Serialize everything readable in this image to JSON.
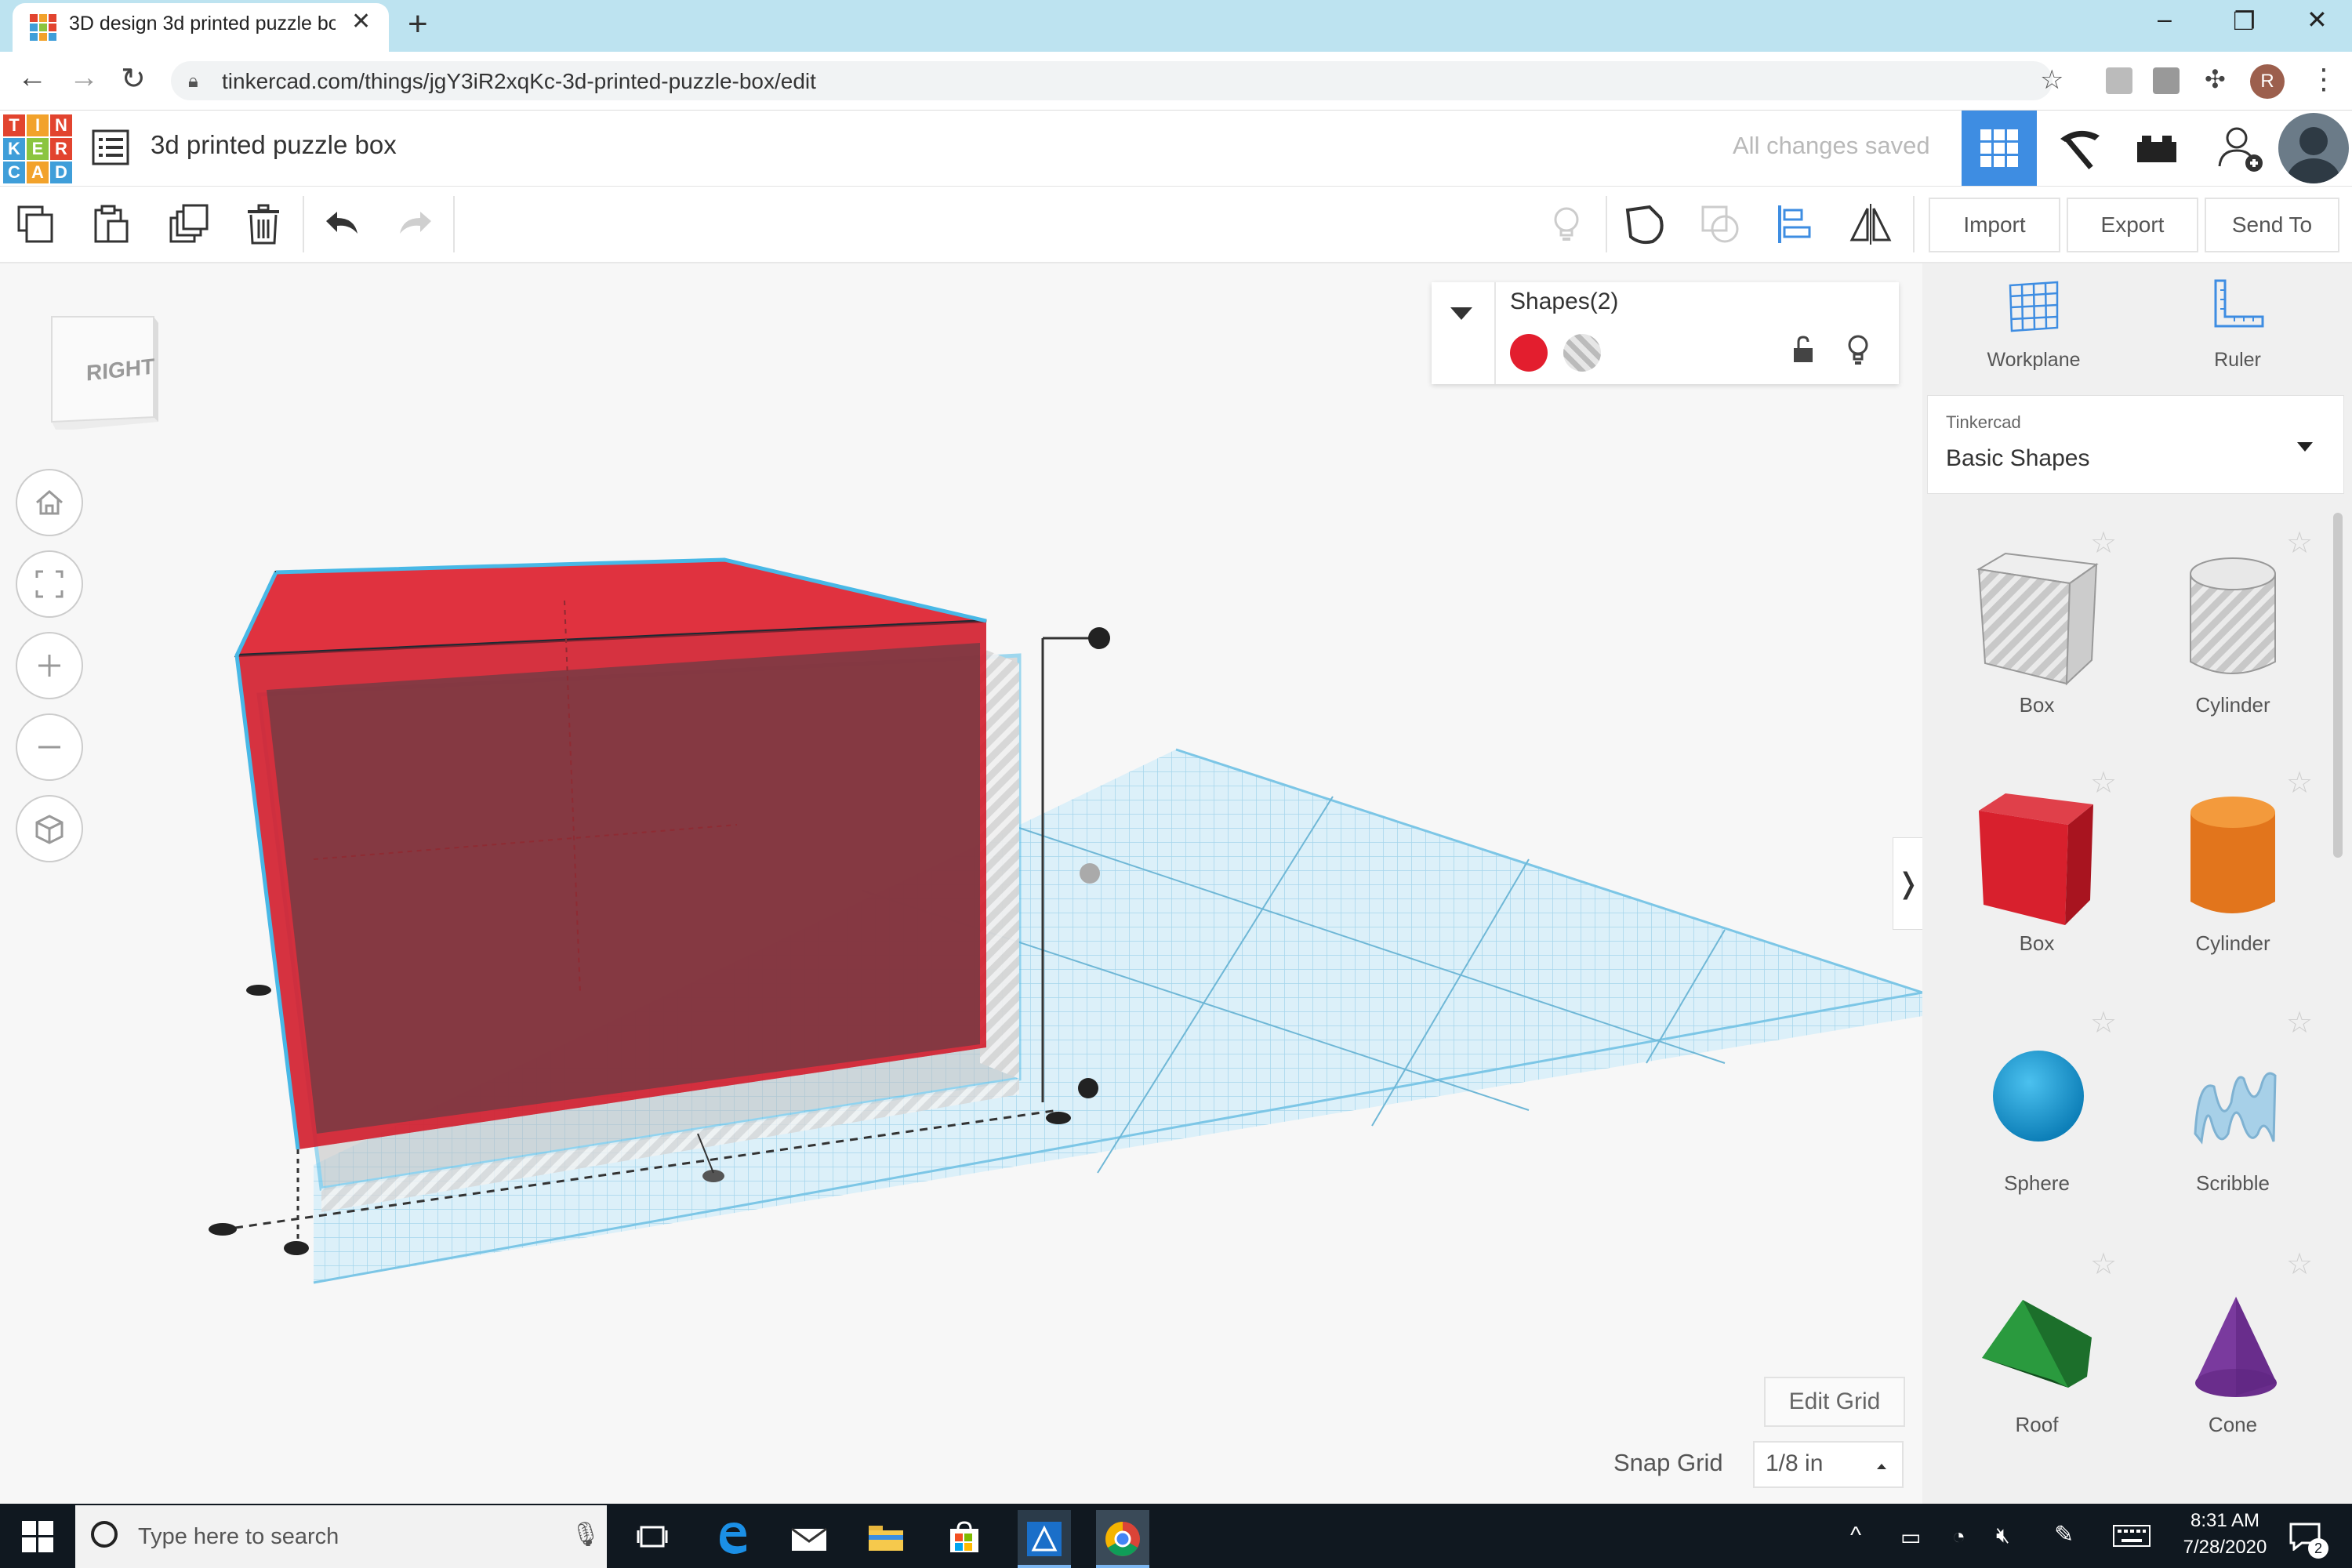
{
  "browser": {
    "tab_title": "3D design 3d printed puzzle box",
    "url": "tinkercad.com/things/jgY3iR2xqKc-3d-printed-puzzle-box/edit",
    "profile_initial": "R"
  },
  "app": {
    "logo_letters": [
      "T",
      "I",
      "N",
      "K",
      "E",
      "R",
      "C",
      "A",
      "D"
    ],
    "logo_colors": [
      "#e2442f",
      "#f2a22b",
      "#e2442f",
      "#3f9ed9",
      "#8bc53f",
      "#e2442f",
      "#3f9ed9",
      "#f2a22b",
      "#3f9ed9"
    ],
    "doc_title": "3d printed puzzle box",
    "save_status": "All changes saved",
    "accent": "#3e8de2"
  },
  "toolbar": {
    "import_label": "Import",
    "export_label": "Export",
    "send_to_label": "Send To"
  },
  "viewcube": {
    "face_label": "RIGHT"
  },
  "inspector": {
    "title": "Shapes(2)",
    "solid_color": "#e31e2e"
  },
  "grid": {
    "edit_label": "Edit Grid",
    "snap_label": "Snap Grid",
    "snap_value": "1/8 in"
  },
  "panel": {
    "workplane_label": "Workplane",
    "ruler_label": "Ruler",
    "library_category": "Tinkercad",
    "library_name": "Basic Shapes",
    "shapes": [
      {
        "label": "Box"
      },
      {
        "label": "Cylinder"
      },
      {
        "label": "Box"
      },
      {
        "label": "Cylinder"
      },
      {
        "label": "Sphere"
      },
      {
        "label": "Scribble"
      },
      {
        "label": "Roof"
      },
      {
        "label": "Cone"
      }
    ]
  },
  "taskbar": {
    "search_placeholder": "Type here to search",
    "time": "8:31 AM",
    "date": "7/28/2020",
    "notification_count": "2"
  }
}
